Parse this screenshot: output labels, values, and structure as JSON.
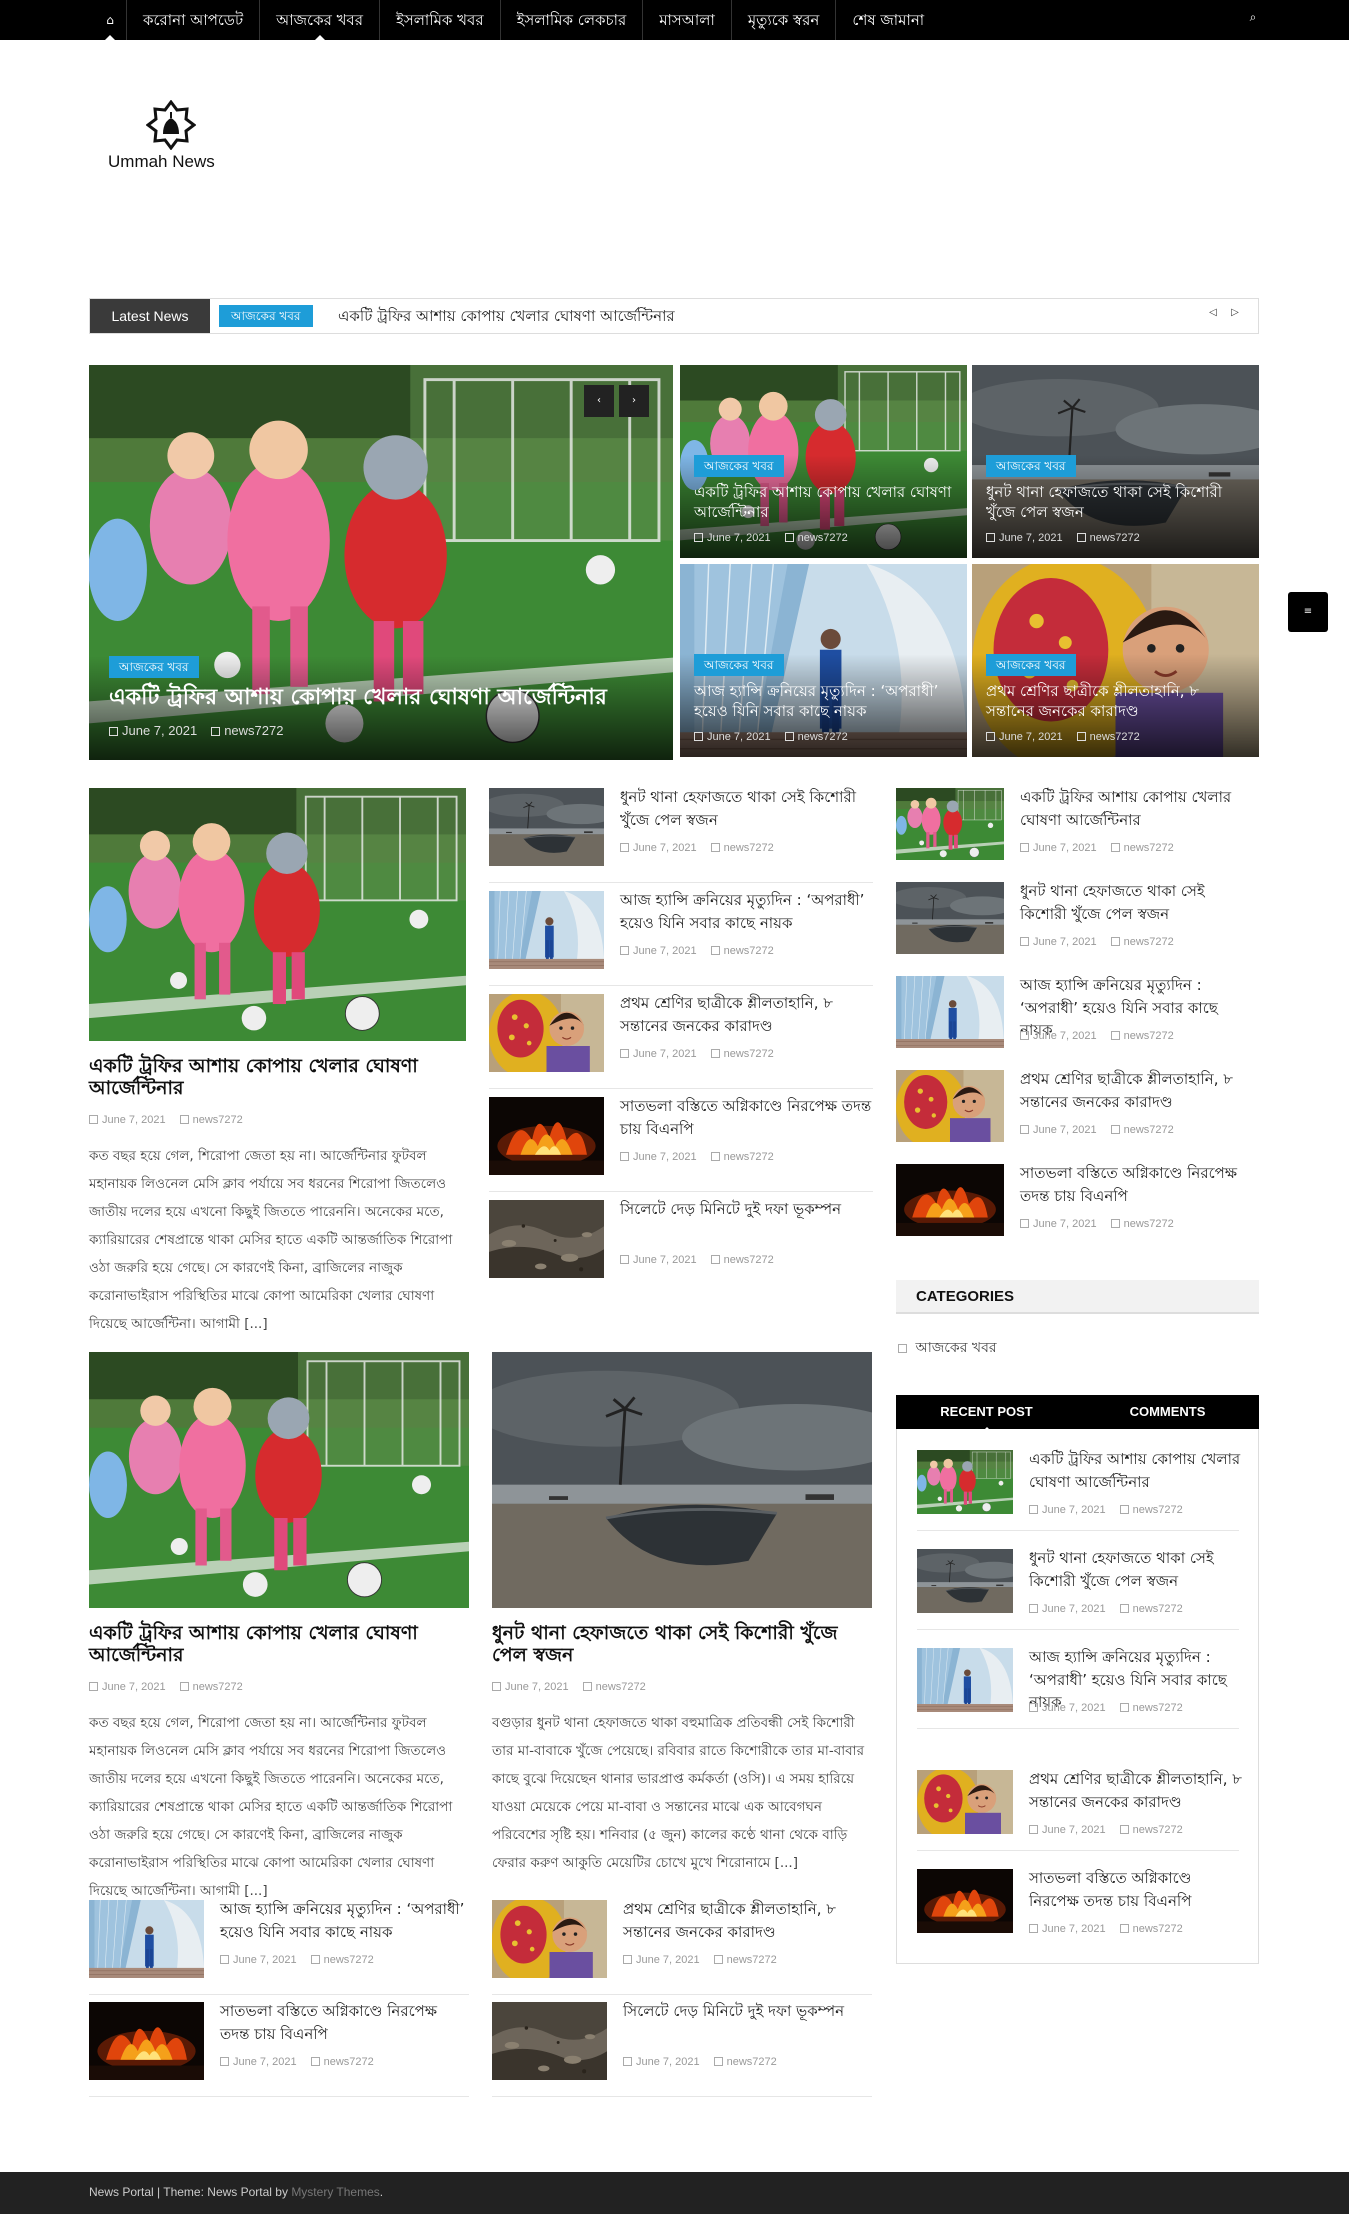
{
  "nav": {
    "items": [
      "করোনা আপডেট",
      "আজকের খবর",
      "ইসলামিক খবর",
      "ইসলামিক লেকচার",
      "মাসআলা",
      "মৃত্যুকে স্বরন",
      "শেষ জামানা"
    ]
  },
  "site": {
    "name": "Ummah News"
  },
  "ticker": {
    "label": "Latest News",
    "category": "আজকের খবর",
    "headline": "একটি ট্রফির আশায় কোপায় খেলার ঘোষণা আর্জেন্টিনার"
  },
  "category": "আজকের খবর",
  "date": "June 7, 2021",
  "author": "news7272",
  "titles": {
    "t1": "একটি ট্রফির আশায় কোপায় খেলার ঘোষণা আর্জেন্টিনার",
    "t2": "ধুনট থানা হেফাজতে থাকা সেই কিশোরী খুঁজে পেল স্বজন",
    "t3": "আজ হ্যান্সি ক্রনিয়ের মৃত্যুদিন : ‘অপরাধী’ হয়েও যিনি সবার কাছে নায়ক",
    "t4": "প্রথম শ্রেণির ছাত্রীকে শ্লীলতাহানি, ৮ সন্তানের জনকের কারাদণ্ড",
    "t5": "সাতভলা বস্তিতে অগ্নিকাণ্ডে নিরপেক্ষ তদন্ত চায় বিএনপি",
    "t6": "সিলেটে দেড় মিনিটে দুই দফা ভূকম্পন"
  },
  "excerpts": {
    "e1": "কত বছর হয়ে গেল, শিরোপা জেতা হয় না। আর্জেন্টিনার ফুটবল মহানায়ক লিওনেল মেসি ক্লাব পর্যায়ে সব ধরনের শিরোপা জিতলেও জাতীয় দলের হয়ে এখনো কিছুই জিততে পারেননি। অনেকের মতে, ক্যারিয়ারের শেষপ্রান্তে থাকা মেসির হাতে একটি আন্তর্জাতিক শিরোপা ওঠা জরুরি হয়ে গেছে। সে কারণেই কিনা, ব্রাজিলের নাজুক করোনাভাইরাস পরিস্থিতির মাঝে কোপা আমেরিকা খেলার ঘোষণা দিয়েছে আর্জেন্টিনা। আগামী [...]",
    "e2": "বগুড়ার ধুনট থানা হেফাজতে থাকা বহুমাত্রিক প্রতিবন্ধী সেই কিশোরী তার মা-বাবাকে খুঁজে পেয়েছে। রবিবার রাতে কিশোরীকে তার মা-বাবার কাছে বুঝে দিয়েছেন থানার ভারপ্রাপ্ত কর্মকর্তা (ওসি)। এ সময় হারিয়ে যাওয়া মেয়েকে পেয়ে মা-বাবা ও সন্তানের মাঝে এক আবেগঘন পরিবেশের সৃষ্টি হয়। শনিবার (৫ জুন) কালের কণ্ঠে থানা থেকে বাড়ি ফেরার করুণ আকুতি মেয়েটির চোখে মুখে শিরোনামে [...]"
  },
  "widgets": {
    "categories_title": "CATEGORIES",
    "category_item": "আজকের খবর",
    "tab_recent": "RECENT POST",
    "tab_comments": "COMMENTS"
  },
  "footer": {
    "text": "News Portal | Theme: News Portal by",
    "link": "Mystery Themes",
    "end": "."
  },
  "colors": {
    "accent": "#1e9dd8",
    "topbar": "#000000"
  }
}
